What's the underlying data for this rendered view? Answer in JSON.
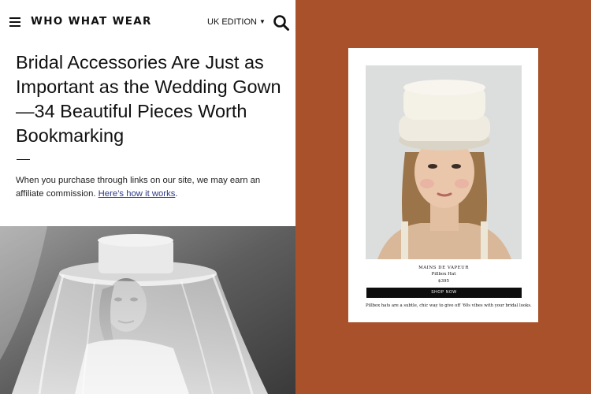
{
  "header": {
    "logo": "WHO WHAT WEAR",
    "edition": "UK EDITION",
    "menu_icon": "hamburger-menu-icon",
    "search_icon": "search-icon"
  },
  "article": {
    "headline": "Bridal Accessories Are Just as Important as the Wedding Gown—34 Beautiful Pieces Worth Bookmarking",
    "disclosure_text": "When you purchase through links on our site, we may earn an affiliate commission. ",
    "disclosure_link": "Here’s how it works",
    "disclosure_end": "."
  },
  "product": {
    "brand": "MAINS DE VAPEUR",
    "name": "Pillbox Hat",
    "price": "$395",
    "button": "SHOP NOW",
    "caption": "Pillbox hats are a subtle, chic way to give off ’60s vibes with your bridal looks."
  },
  "colors": {
    "panel_background": "#a8512a",
    "button_background": "#0d0d0d",
    "link": "#2e3a88"
  }
}
